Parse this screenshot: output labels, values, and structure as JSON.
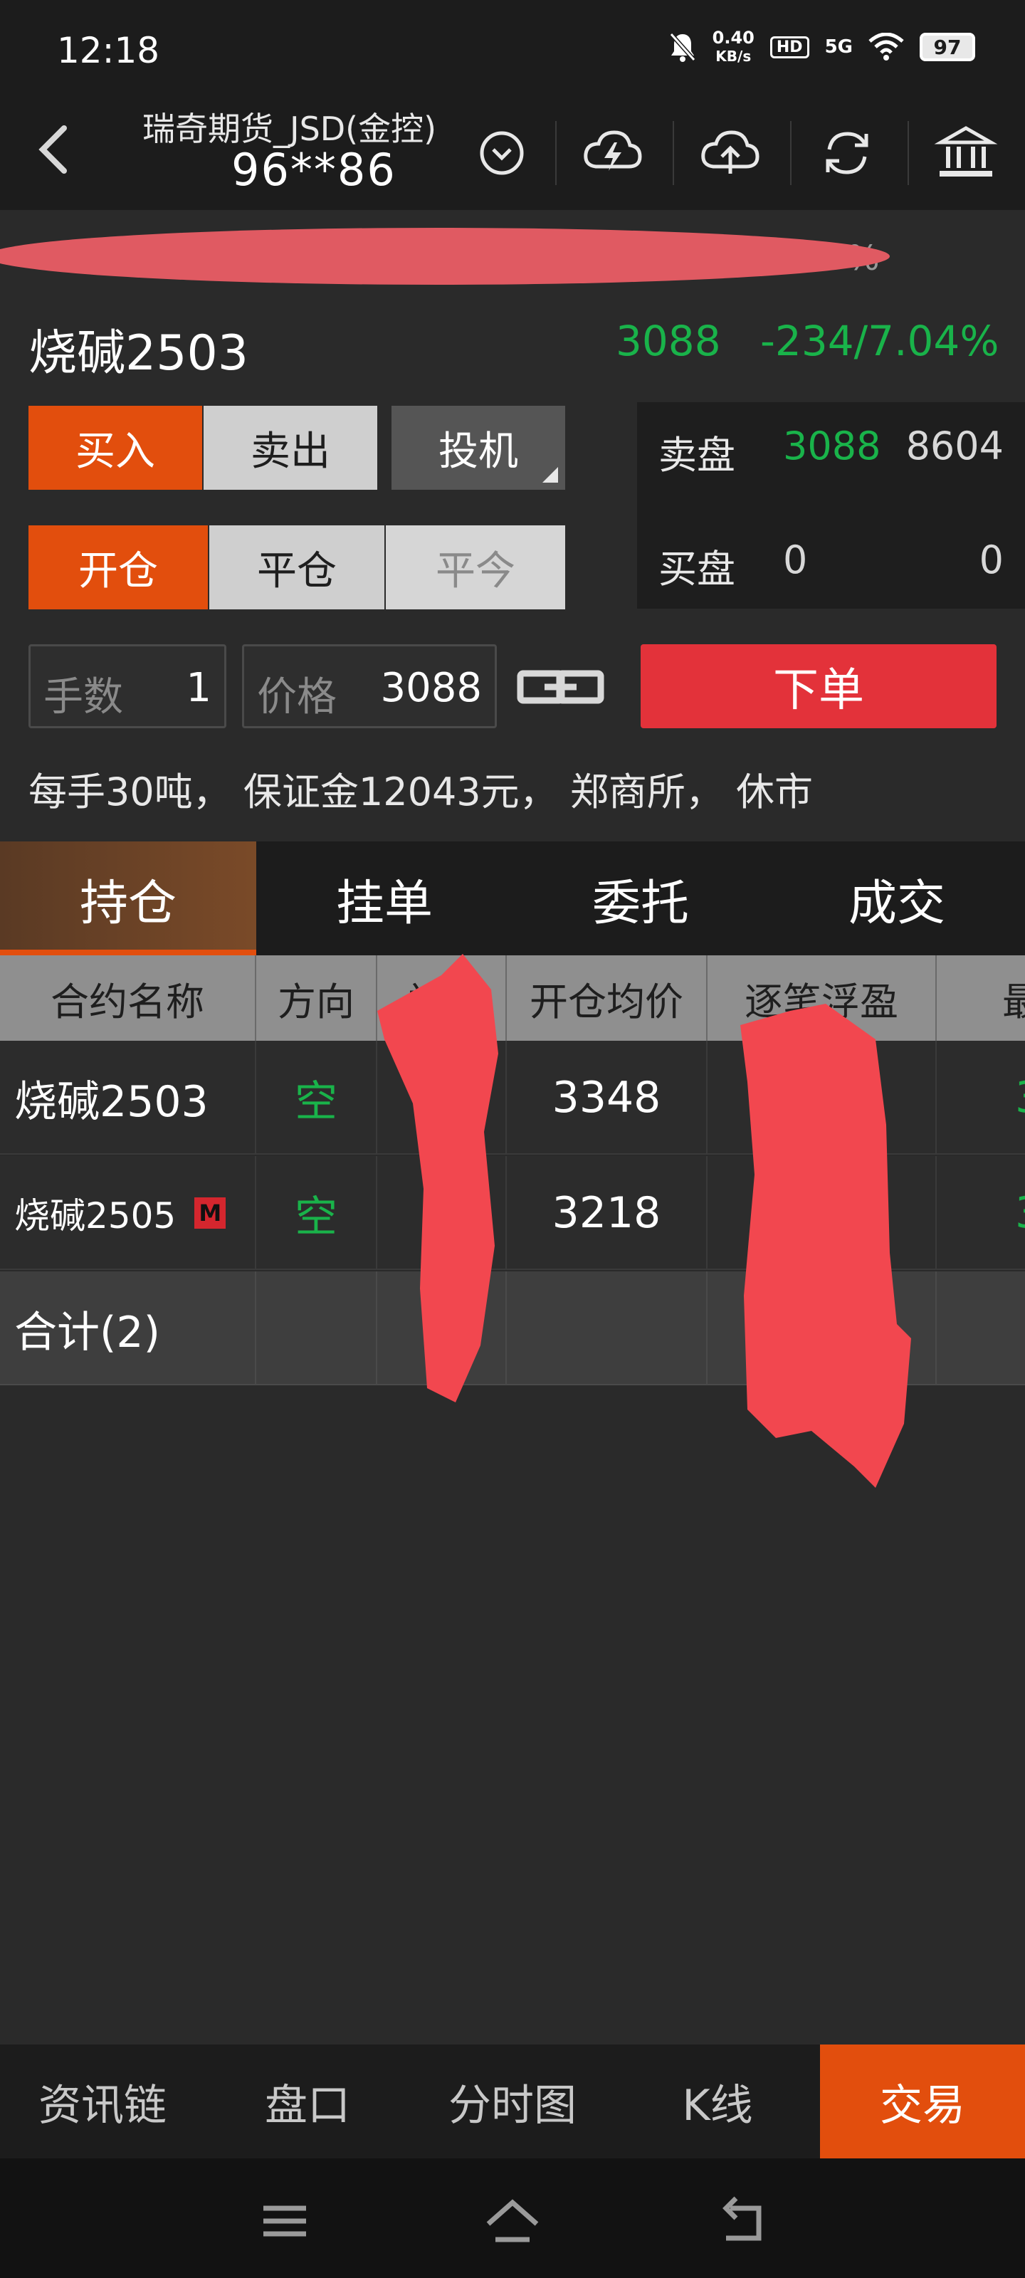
{
  "status_bar": {
    "time": "12:18",
    "net_speed": "0.40",
    "net_unit": "KB/s",
    "hd": "HD",
    "signal": "5G",
    "battery": "97"
  },
  "header": {
    "account_name": "瑞奇期货_JSD(金控)",
    "account_id": "96**86"
  },
  "banner": {
    "text_fragment": "%"
  },
  "quote": {
    "product": "烧碱2503",
    "last_price": "3088",
    "change": "-234/7.04%"
  },
  "order": {
    "buy_label": "买入",
    "sell_label": "卖出",
    "type_label": "投机",
    "open_label": "开仓",
    "close_label": "平仓",
    "close_today_label": "平今",
    "qty_label": "手数",
    "qty_value": "1",
    "price_label": "价格",
    "price_value": "3088",
    "submit_label": "下单",
    "info": "每手30吨， 保证金12043元， 郑商所， 休市"
  },
  "book": {
    "ask_label": "卖盘",
    "ask_price": "3088",
    "ask_vol": "8604",
    "bid_label": "买盘",
    "bid_price": "0",
    "bid_vol": "0"
  },
  "tabs": [
    "持仓",
    "挂单",
    "委托",
    "成交"
  ],
  "table": {
    "headers": [
      "合约名称",
      "方向",
      "总仓",
      "开仓均价",
      "逐笔浮盈",
      "最"
    ],
    "rows": [
      {
        "name": "烧碱2503",
        "badge": "",
        "dir": "空",
        "avg": "3348",
        "last": "3"
      },
      {
        "name": "烧碱2505",
        "badge": "M",
        "dir": "空",
        "avg": "3218",
        "last": "3"
      }
    ],
    "total_label": "合计(2)"
  },
  "bottom_nav": [
    "资讯链",
    "盘口",
    "分时图",
    "K线",
    "交易"
  ],
  "colors": {
    "accent": "#e24e0d",
    "down": "#19b34a",
    "submit": "#e3323a"
  }
}
